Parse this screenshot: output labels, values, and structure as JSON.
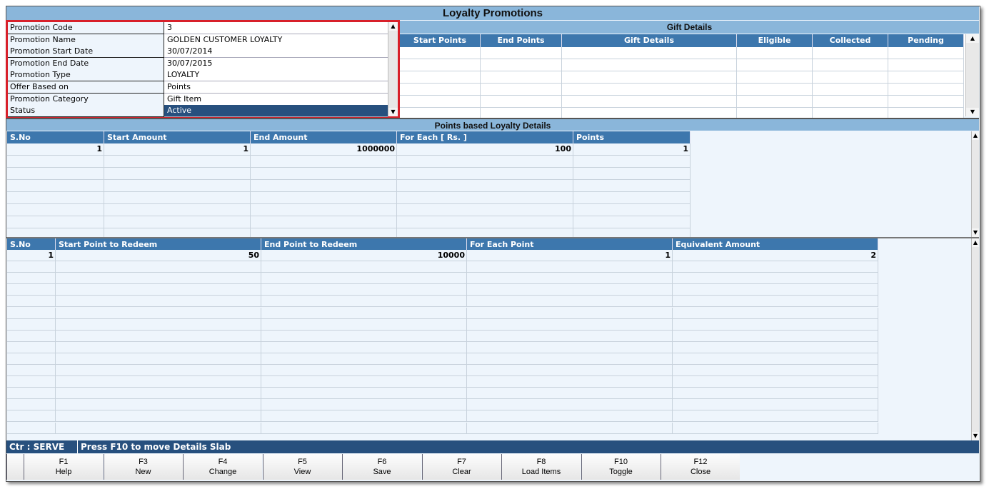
{
  "title": "Loyalty Promotions",
  "form": [
    {
      "label": "Promotion Code",
      "value": "3"
    },
    {
      "label": "Promotion Name",
      "value": "GOLDEN CUSTOMER LOYALTY"
    },
    {
      "label": "Promotion Start Date",
      "value": "30/07/2014"
    },
    {
      "label": "Promotion End Date",
      "value": "30/07/2015"
    },
    {
      "label": "Promotion Type",
      "value": "LOYALTY"
    },
    {
      "label": "Offer Based on",
      "value": "Points"
    },
    {
      "label": "Promotion Category",
      "value": "Gift Item"
    },
    {
      "label": "Status",
      "value": "Active"
    }
  ],
  "gift": {
    "title": "Gift Details",
    "columns": [
      "Start Points",
      "End Points",
      "Gift Details",
      "Eligible",
      "Collected",
      "Pending"
    ]
  },
  "points": {
    "title": "Points based Loyalty Details",
    "columns": [
      "S.No",
      "Start Amount",
      "End Amount",
      "For Each [ Rs. ]",
      "Points"
    ],
    "rows": [
      [
        "1",
        "1",
        "1000000",
        "100",
        "1"
      ]
    ]
  },
  "redeem": {
    "columns": [
      "S.No",
      "Start Point to Redeem",
      "End Point to Redeem",
      "For Each Point",
      "Equivalent Amount"
    ],
    "rows": [
      [
        "1",
        "50",
        "10000",
        "1",
        "2"
      ]
    ]
  },
  "status": {
    "counter": "Ctr : SERVE",
    "message": "Press F10 to move Details Slab"
  },
  "buttons": [
    {
      "key": "F1",
      "label": "Help"
    },
    {
      "key": "F3",
      "label": "New"
    },
    {
      "key": "F4",
      "label": "Change"
    },
    {
      "key": "F5",
      "label": "View"
    },
    {
      "key": "F6",
      "label": "Save"
    },
    {
      "key": "F7",
      "label": "Clear"
    },
    {
      "key": "F8",
      "label": "Load Items"
    },
    {
      "key": "F10",
      "label": "Toggle"
    },
    {
      "key": "F12",
      "label": "Close"
    }
  ]
}
